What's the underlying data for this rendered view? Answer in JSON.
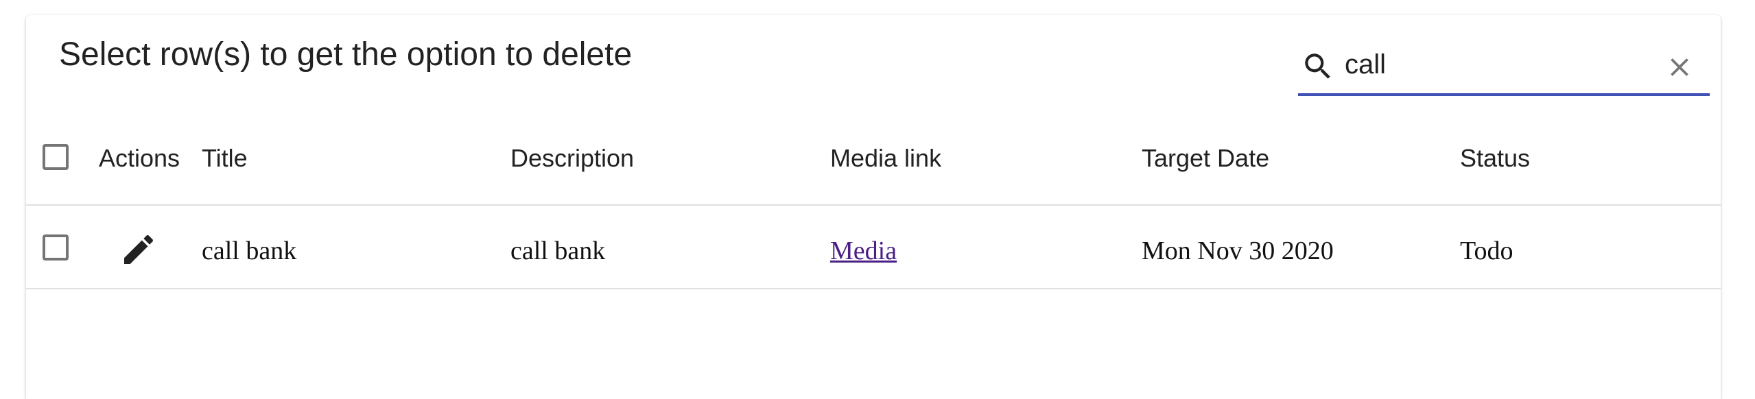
{
  "header": {
    "title": "Select row(s) to get the option to delete"
  },
  "search": {
    "value": "call",
    "icon": "search-icon",
    "clear_icon": "close-icon",
    "accent_color": "#3f51b5"
  },
  "table": {
    "columns": {
      "actions": "Actions",
      "title": "Title",
      "description": "Description",
      "media": "Media link",
      "target_date": "Target Date",
      "status": "Status"
    },
    "rows": [
      {
        "title": "call bank",
        "description": "call bank",
        "media": "Media",
        "target_date": "Mon Nov 30 2020",
        "status": "Todo",
        "action_icon": "edit-icon",
        "selected": false
      }
    ]
  },
  "colors": {
    "link": "#4a1f86",
    "checkbox_border": "#757575",
    "divider": "#e0e0e0"
  }
}
